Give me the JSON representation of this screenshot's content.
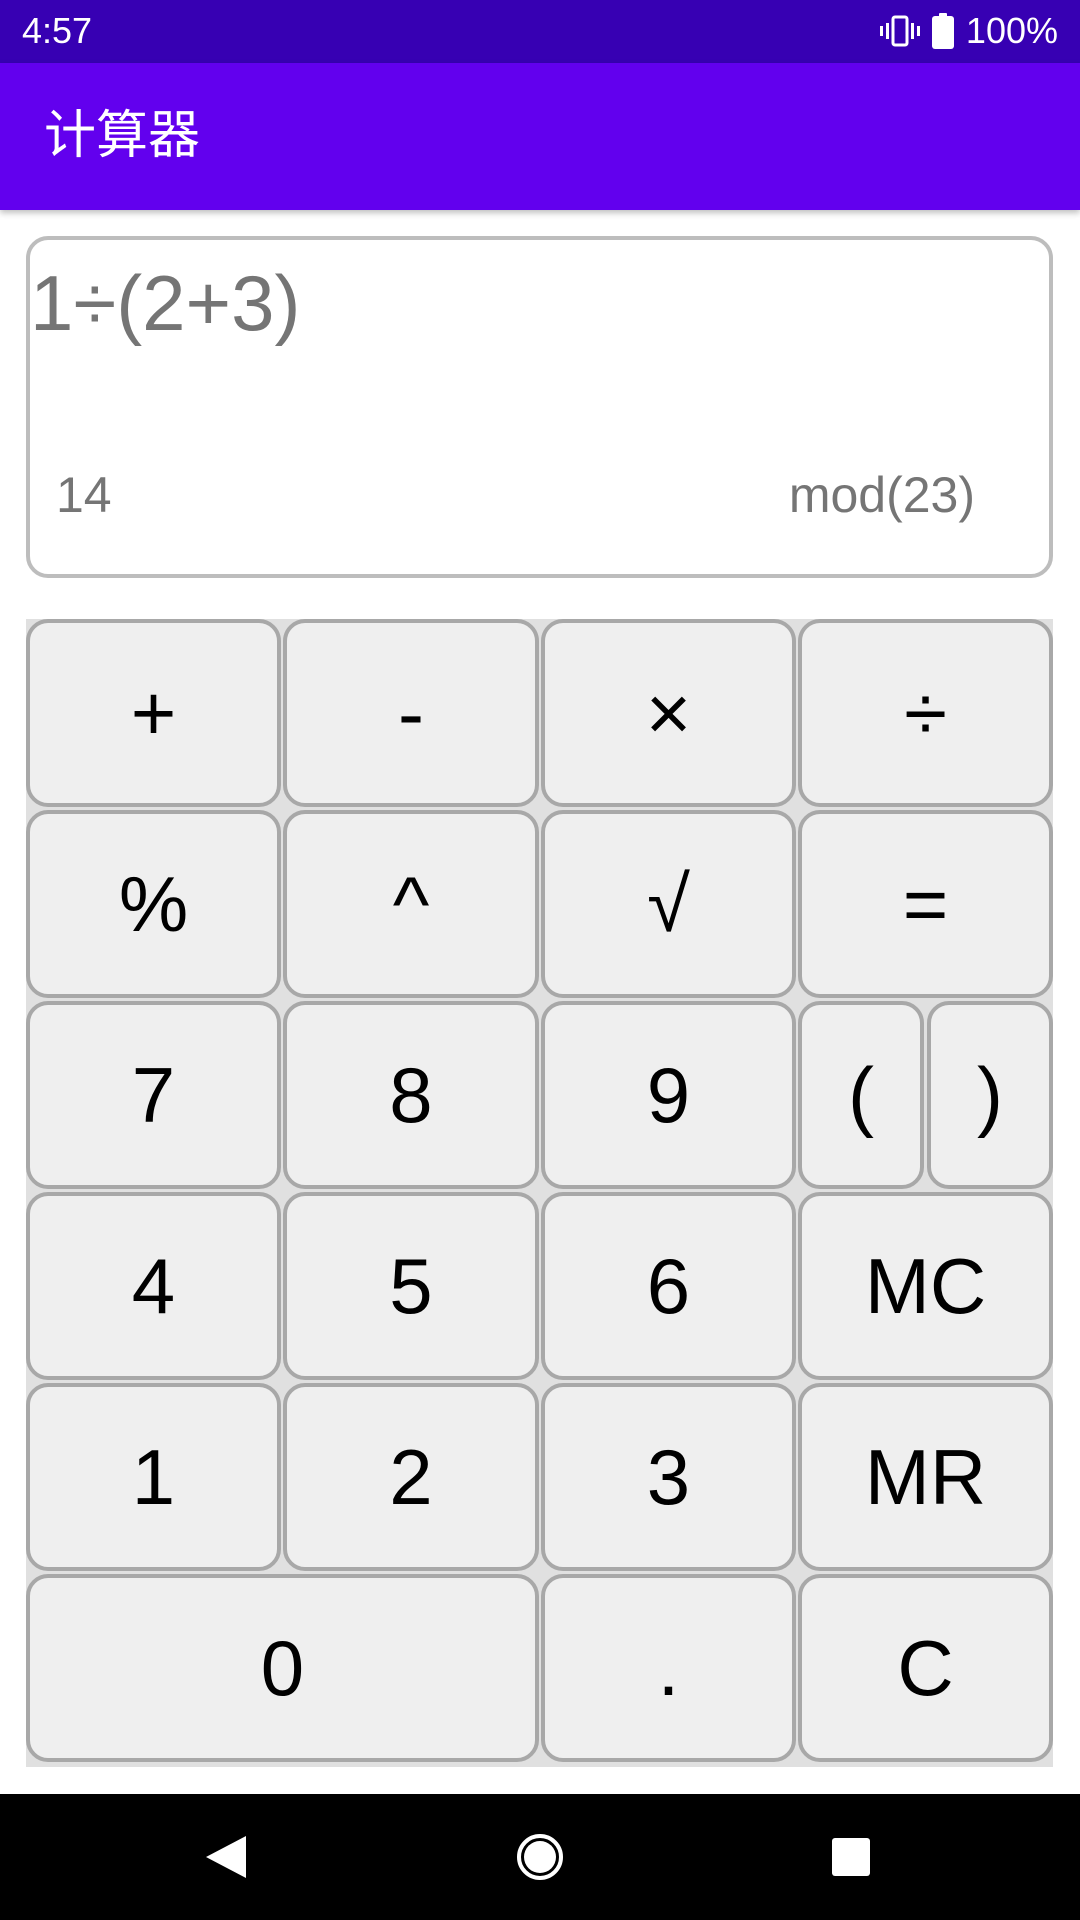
{
  "status_bar": {
    "time": "4:57",
    "battery_level": "100%",
    "vibrate_icon": "vibrate-icon",
    "battery_icon": "battery-full-icon"
  },
  "app_bar": {
    "title": "计算器",
    "background_color": "#6200ee",
    "status_color": "#3700b3"
  },
  "display": {
    "expression": "1÷(2+3)",
    "memory_value": "14",
    "mod_label": "mod(23)"
  },
  "keypad": {
    "rows": [
      [
        "+",
        "-",
        "×",
        "÷"
      ],
      [
        "%",
        "^",
        "√",
        "="
      ],
      [
        "7",
        "8",
        "9",
        "(",
        ")"
      ],
      [
        "4",
        "5",
        "6",
        "MC"
      ],
      [
        "1",
        "2",
        "3",
        "MR"
      ],
      [
        "0",
        ".",
        "C"
      ]
    ]
  },
  "nav_bar": {
    "back_icon": "back-triangle-icon",
    "home_icon": "home-circle-icon",
    "recents_icon": "recents-square-icon"
  }
}
